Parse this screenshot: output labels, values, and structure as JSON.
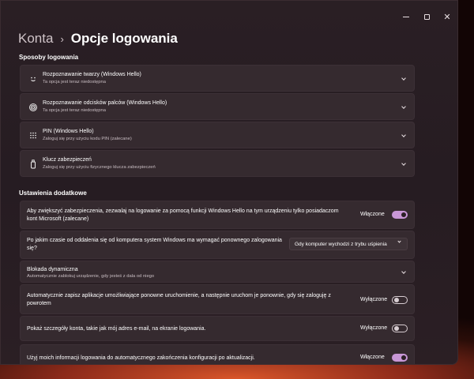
{
  "breadcrumb": {
    "parent": "Konta",
    "separator": "›",
    "current": "Opcje logowania"
  },
  "sign_in_methods": {
    "title": "Sposoby logowania",
    "items": [
      {
        "icon": "face-icon",
        "title": "Rozpoznawanie twarzy (Windows Hello)",
        "subtitle": "Ta opcja jest teraz niedostępna"
      },
      {
        "icon": "fingerprint-icon",
        "title": "Rozpoznawanie odcisków palców (Windows Hello)",
        "subtitle": "Ta opcja jest teraz niedostępna"
      },
      {
        "icon": "pin-keypad-icon",
        "title": "PIN (Windows Hello)",
        "subtitle": "Zaloguj się przy użyciu kodu PIN (zalecane)"
      },
      {
        "icon": "security-key-icon",
        "title": "Klucz zabezpieczeń",
        "subtitle": "Zaloguj się przy użyciu fizycznego klucza zabezpieczeń"
      }
    ]
  },
  "additional": {
    "title": "Ustawienia dodatkowe",
    "hello_only": {
      "text1": "Aby zwiększyć zabezpieczenia, zezwalaj na logowanie za pomocą funkcji Windows Hello na tym urządzeniu tylko posiadaczom",
      "text2": "kont Microsoft (zalecane)",
      "state_label": "Włączone",
      "on": true
    },
    "require_signin": {
      "text1": "Po jakim czasie od oddalenia się od komputera system Windows ma wymagać ponownego zalogowania",
      "text2": "się?",
      "selected": "Gdy komputer wychodzi z trybu uśpienia"
    },
    "dynamic_lock": {
      "title": "Blokada dynamiczna",
      "subtitle": "Automatycznie zablokuj urządzenie, gdy jesteś z dala od niego"
    },
    "restart_apps": {
      "text1": "Automatycznie zapisz aplikacje umożliwiające ponowne uruchomienie, a następnie uruchom je ponownie, gdy się zaloguję z",
      "text2": "powrotem",
      "state_label": "Wyłączone",
      "on": false
    },
    "show_account": {
      "text": "Pokaż szczegóły konta, takie jak mój adres e-mail, na ekranie logowania.",
      "state_label": "Wyłączone",
      "on": false
    },
    "use_signin_info": {
      "text": "Użyj moich informacji logowania do automatycznego zakończenia konfiguracji po aktualizacji.",
      "state_label": "Włączone",
      "on": true
    }
  },
  "window_controls": {
    "minimize": "minimize-icon",
    "maximize": "maximize-icon",
    "close": "close-icon"
  },
  "colors": {
    "toggle_on": "#c897d6",
    "card": "#352a2f",
    "window": "#2a1f24"
  }
}
